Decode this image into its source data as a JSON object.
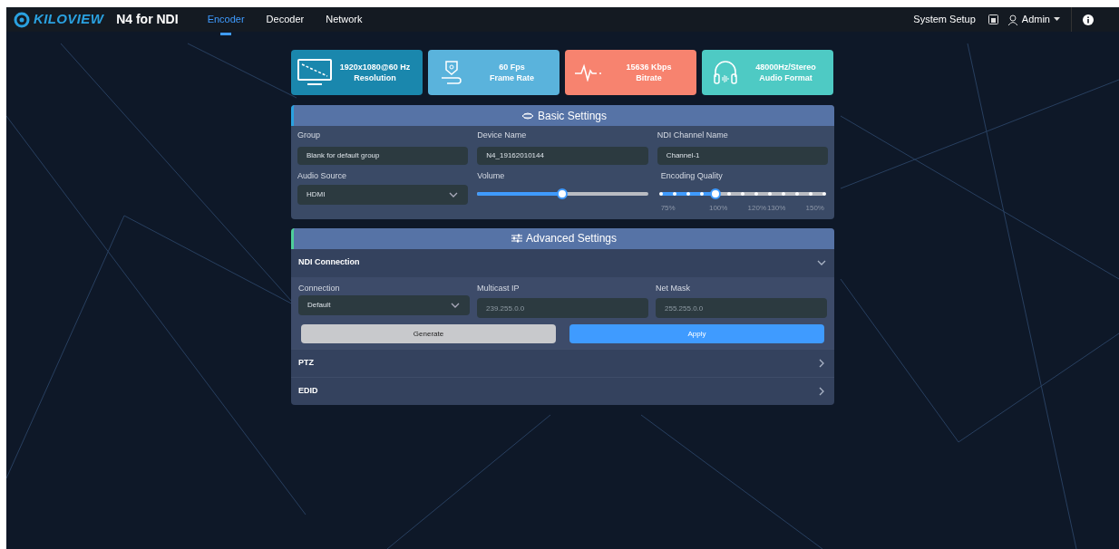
{
  "nav": {
    "brand": "KILOVIEW",
    "product": "N4 for NDI",
    "tabs": [
      {
        "label": "Encoder",
        "selected": true
      },
      {
        "label": "Decoder",
        "selected": false
      },
      {
        "label": "Network",
        "selected": false
      }
    ],
    "system_setup": "System Setup",
    "user": "Admin"
  },
  "status_cards": [
    {
      "kind": "monitor",
      "value": "1920x1080@60 Hz",
      "label": "Resolution",
      "color": "#1a87ad"
    },
    {
      "kind": "pin",
      "value": "60 Fps",
      "label": "Frame Rate",
      "color": "#5ab3dc"
    },
    {
      "kind": "pulse",
      "value": "15636 Kbps",
      "label": "Bitrate",
      "color": "#f7836f"
    },
    {
      "kind": "headphones",
      "value": "48000Hz/Stereo",
      "label": "Audio Format",
      "color": "#4ecac4"
    }
  ],
  "basic_settings": {
    "title": "Basic Settings",
    "group": {
      "label": "Group",
      "placeholder": "Blank for default group"
    },
    "device_name": {
      "label": "Device Name",
      "value": "N4_19162010144"
    },
    "ndi_channel_name": {
      "label": "NDI Channel Name",
      "value": "Channel-1"
    },
    "audio_source": {
      "label": "Audio Source",
      "value": "HDMI"
    },
    "volume": {
      "label": "Volume",
      "level": 0.5
    },
    "encoding_quality": {
      "label": "Encoding Quality",
      "level": 0.333,
      "ticks": [
        "75%",
        "100%",
        "120%",
        "130%",
        "150%"
      ]
    }
  },
  "advanced_settings": {
    "title": "Advanced Settings",
    "sections": [
      {
        "title": "NDI Connection",
        "expanded": true
      },
      {
        "title": "PTZ",
        "expanded": false
      },
      {
        "title": "EDID",
        "expanded": false
      }
    ],
    "connection": {
      "label": "Connection",
      "value": "Default"
    },
    "multicast_ip": {
      "label": "Multicast IP",
      "placeholder": "239.255.0.0"
    },
    "net_mask": {
      "label": "Net Mask",
      "placeholder": "255.255.0.0"
    },
    "buttons": [
      {
        "kind": "secondary",
        "label": "Generate"
      },
      {
        "kind": "primary",
        "label": "Apply"
      }
    ]
  }
}
